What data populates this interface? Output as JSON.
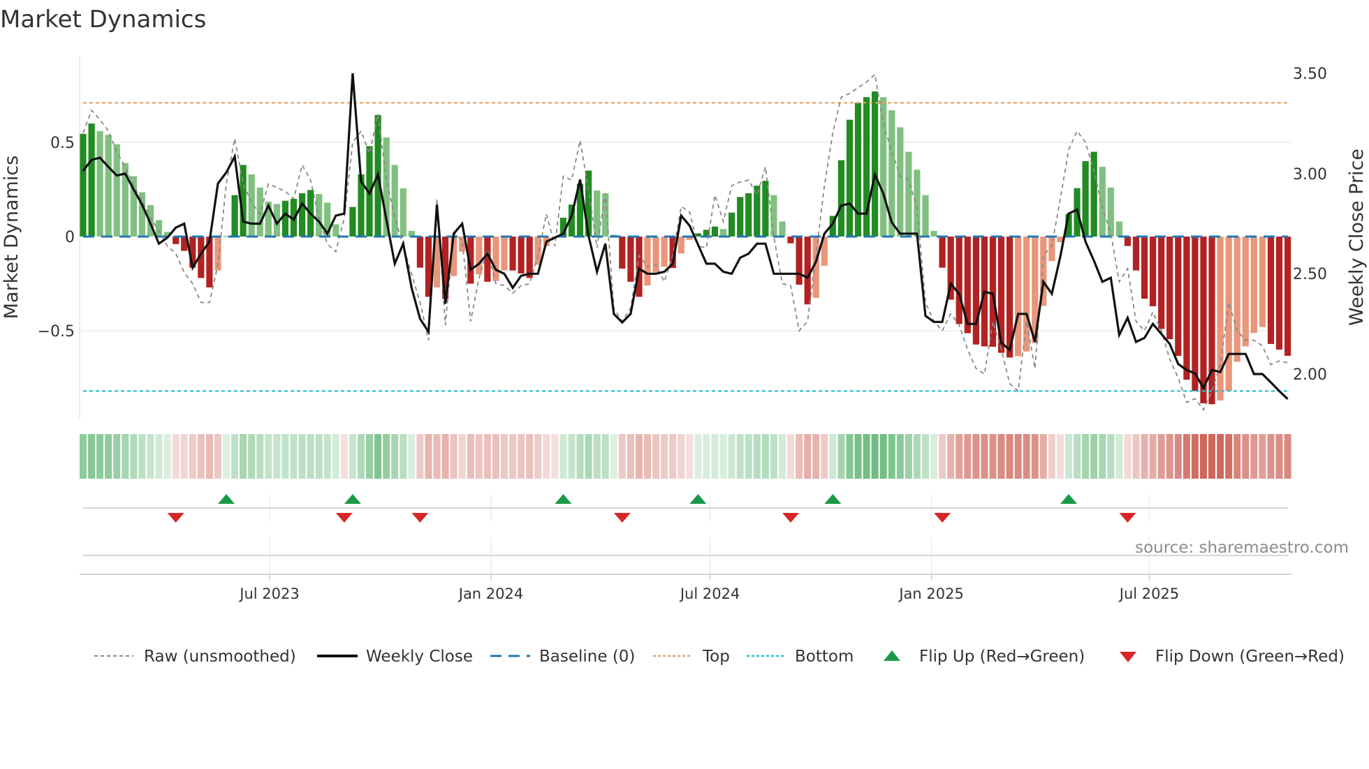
{
  "chart_data": {
    "type": "bar",
    "title": "Market Dynamics",
    "ylabel": "Market Dynamics",
    "ylabel_right": "Weekly Close Price",
    "ylim": [
      -0.95,
      0.95
    ],
    "ylim_right": [
      1.8,
      3.6
    ],
    "yticks_left": [
      {
        "value": 0.5,
        "label": "0.5"
      },
      {
        "value": 0,
        "label": "0"
      },
      {
        "value": -0.5,
        "label": "−0.5"
      }
    ],
    "yticks_right": [
      {
        "value": 3.5,
        "label": "3.50"
      },
      {
        "value": 3.0,
        "label": "3.00"
      },
      {
        "value": 2.5,
        "label": "2.50"
      },
      {
        "value": 2.0,
        "label": "2.00"
      }
    ],
    "xticks": [
      {
        "label": "Jul 2023",
        "date": "2023-07-01"
      },
      {
        "label": "Jan 2024",
        "date": "2024-01-01"
      },
      {
        "label": "Jul 2024",
        "date": "2024-07-01"
      },
      {
        "label": "Jan 2025",
        "date": "2025-01-01"
      },
      {
        "label": "Jul 2025",
        "date": "2025-07-01"
      }
    ],
    "x_start": "2023-01-27",
    "x_step_days": 7,
    "top_level": 0.71,
    "bottom_level": -0.82,
    "baseline": 0,
    "values": [
      0.545,
      0.6,
      0.56,
      0.54,
      0.49,
      0.39,
      0.32,
      0.235,
      0.167,
      0.087,
      0.025,
      -0.04,
      -0.076,
      -0.165,
      -0.22,
      -0.27,
      -0.18,
      0.002,
      0.22,
      0.38,
      0.33,
      0.26,
      0.186,
      0.173,
      0.19,
      0.2,
      0.23,
      0.247,
      0.226,
      0.18,
      0.065,
      -0.005,
      0.157,
      0.33,
      0.48,
      0.645,
      0.526,
      0.38,
      0.256,
      0.03,
      -0.165,
      -0.32,
      -0.27,
      -0.33,
      -0.21,
      -0.08,
      -0.25,
      -0.2,
      -0.24,
      -0.236,
      -0.18,
      -0.18,
      -0.196,
      -0.22,
      -0.15,
      -0.05,
      -0.005,
      0.1,
      0.17,
      0.28,
      0.35,
      0.245,
      0.23,
      0.01,
      -0.17,
      -0.24,
      -0.32,
      -0.26,
      -0.19,
      -0.16,
      -0.167,
      -0.09,
      -0.017,
      0.017,
      0.036,
      0.053,
      0.04,
      0.127,
      0.21,
      0.23,
      0.27,
      0.296,
      0.22,
      0.08,
      -0.036,
      -0.255,
      -0.36,
      -0.325,
      -0.155,
      0.11,
      0.405,
      0.62,
      0.71,
      0.74,
      0.77,
      0.74,
      0.67,
      0.58,
      0.45,
      0.355,
      0.22,
      0.03,
      -0.165,
      -0.335,
      -0.464,
      -0.513,
      -0.573,
      -0.583,
      -0.585,
      -0.617,
      -0.642,
      -0.635,
      -0.61,
      -0.565,
      -0.368,
      -0.13,
      -0.03,
      0.12,
      0.257,
      0.4,
      0.45,
      0.37,
      0.26,
      0.08,
      -0.05,
      -0.18,
      -0.33,
      -0.37,
      -0.49,
      -0.545,
      -0.633,
      -0.76,
      -0.82,
      -0.885,
      -0.89,
      -0.87,
      -0.82,
      -0.665,
      -0.583,
      -0.512,
      -0.48,
      -0.57,
      -0.6,
      -0.633
    ],
    "raw": [
      0.55,
      0.67,
      0.62,
      0.56,
      0.45,
      0.37,
      0.27,
      0.19,
      0.1,
      0.03,
      -0.05,
      -0.09,
      -0.19,
      -0.25,
      -0.35,
      -0.35,
      -0.15,
      0.28,
      0.52,
      0.28,
      0.18,
      0.12,
      0.28,
      0.26,
      0.24,
      0.2,
      0.38,
      0.3,
      0.1,
      -0.04,
      -0.08,
      0.1,
      0.5,
      0.56,
      0.44,
      0.65,
      0.3,
      0.1,
      -0.05,
      -0.2,
      -0.35,
      -0.55,
      0.2,
      -0.47,
      0.02,
      -0.02,
      -0.45,
      -0.22,
      -0.07,
      -0.25,
      -0.26,
      -0.3,
      -0.26,
      -0.25,
      -0.1,
      0.12,
      -0.05,
      0.32,
      0.3,
      0.51,
      0.25,
      -0.06,
      0.23,
      -0.38,
      -0.45,
      -0.38,
      -0.1,
      -0.16,
      -0.15,
      -0.24,
      -0.1,
      0.16,
      0.13,
      -0.05,
      -0.06,
      0.22,
      0.08,
      0.27,
      0.29,
      0.3,
      0.22,
      0.37,
      0.0,
      -0.25,
      -0.26,
      -0.5,
      -0.45,
      -0.1,
      0.27,
      0.55,
      0.74,
      0.76,
      0.79,
      0.82,
      0.86,
      0.6,
      0.45,
      0.32,
      0.3,
      0.15,
      -0.35,
      -0.45,
      -0.5,
      -0.41,
      -0.47,
      -0.6,
      -0.7,
      -0.73,
      -0.45,
      -0.6,
      -0.78,
      -0.82,
      -0.45,
      -0.7,
      -0.1,
      -0.05,
      0.2,
      0.46,
      0.56,
      0.5,
      0.35,
      0.15,
      0.02,
      -0.24,
      -0.17,
      -0.45,
      -0.5,
      -0.4,
      -0.5,
      -0.65,
      -0.75,
      -0.88,
      -0.86,
      -0.92,
      -0.82,
      -0.68,
      -0.35,
      -0.5,
      -0.55,
      -0.55,
      -0.58,
      -0.68,
      -0.66,
      -0.67
    ],
    "close": [
      3.013,
      3.068,
      3.079,
      3.033,
      2.99,
      3.0,
      2.92,
      2.845,
      2.75,
      2.65,
      2.68,
      2.73,
      2.75,
      2.53,
      2.6,
      2.66,
      2.95,
      3.005,
      3.085,
      2.76,
      2.75,
      2.75,
      2.84,
      2.75,
      2.8,
      2.77,
      2.85,
      2.8,
      2.76,
      2.7,
      2.79,
      2.8,
      3.5,
      2.96,
      2.9,
      2.995,
      2.77,
      2.55,
      2.65,
      2.43,
      2.275,
      2.21,
      2.845,
      2.35,
      2.7,
      2.75,
      2.52,
      2.55,
      2.6,
      2.52,
      2.5,
      2.43,
      2.49,
      2.5,
      2.5,
      2.66,
      2.68,
      2.7,
      2.79,
      2.97,
      2.69,
      2.51,
      2.65,
      2.3,
      2.257,
      2.3,
      2.525,
      2.5,
      2.5,
      2.51,
      2.55,
      2.79,
      2.74,
      2.645,
      2.55,
      2.55,
      2.51,
      2.5,
      2.58,
      2.6,
      2.65,
      2.65,
      2.5,
      2.5,
      2.5,
      2.5,
      2.48,
      2.56,
      2.7,
      2.75,
      2.84,
      2.85,
      2.8,
      2.8,
      2.995,
      2.9,
      2.755,
      2.7,
      2.7,
      2.7,
      2.29,
      2.26,
      2.26,
      2.45,
      2.4,
      2.25,
      2.25,
      2.41,
      2.4,
      2.156,
      2.12,
      2.3,
      2.3,
      2.16,
      2.46,
      2.4,
      2.585,
      2.8,
      2.82,
      2.66,
      2.565,
      2.46,
      2.48,
      2.195,
      2.28,
      2.16,
      2.18,
      2.25,
      2.2,
      2.15,
      2.05,
      2.02,
      2.003,
      1.93,
      2.02,
      2.01,
      2.1,
      2.1,
      2.1,
      2.0,
      2.0,
      1.958,
      1.915,
      1.875
    ],
    "colors": {
      "strong_up": "#228b22",
      "weak_up": "#80c080",
      "strong_down": "#b22222",
      "weak_down": "#e9967a",
      "close": "#111111",
      "raw": "#888888",
      "baseline": "#1f77b4",
      "top": "#e8a060",
      "bottom": "#2bbfd0",
      "flip_up": "#1a9a48",
      "flip_down": "#d62728",
      "strip_green": "#2e9e48",
      "strip_red": "#c0392b"
    },
    "legend": {
      "position": "bottom",
      "items": [
        {
          "label": "Raw (unsmoothed)"
        },
        {
          "label": "Weekly Close"
        },
        {
          "label": "Baseline (0)"
        },
        {
          "label": "Top"
        },
        {
          "label": "Bottom"
        },
        {
          "label": "Flip Up (Red→Green)"
        },
        {
          "label": "Flip Down (Green→Red)"
        }
      ]
    },
    "source": "source: sharemaestro.com"
  }
}
